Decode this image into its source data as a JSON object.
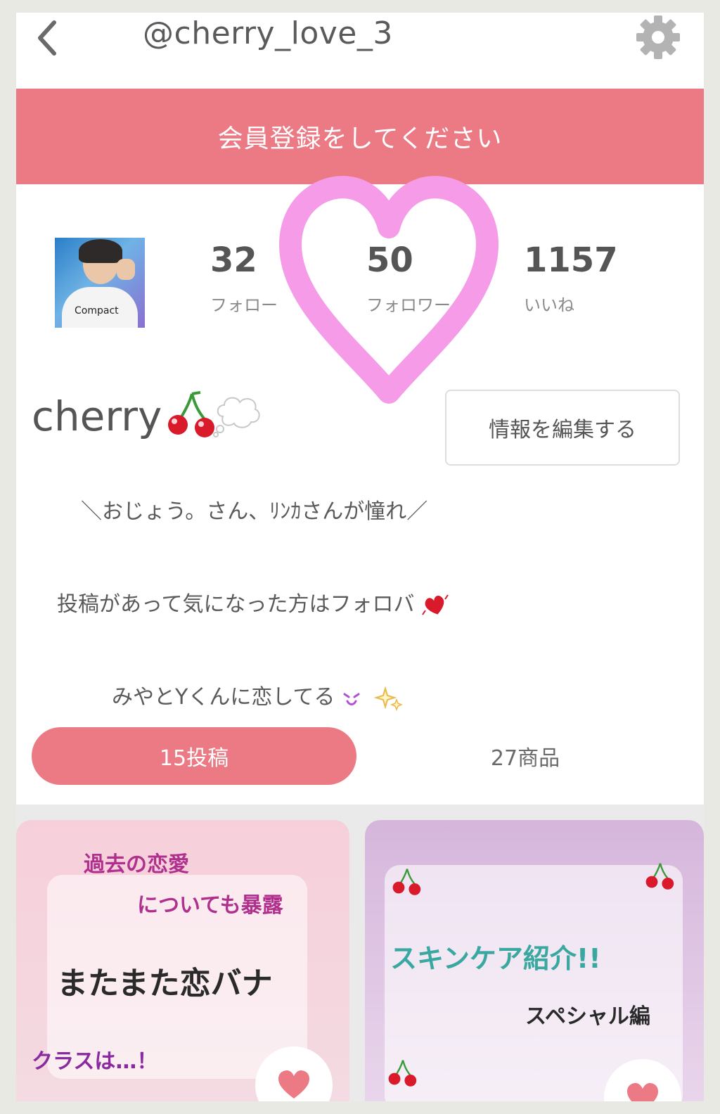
{
  "header": {
    "username": "@cherry_love_3"
  },
  "banner": {
    "text": "会員登録をしてください"
  },
  "stats": [
    {
      "value": "32",
      "label": "フォロー"
    },
    {
      "value": "50",
      "label": "フォロワー"
    },
    {
      "value": "1157",
      "label": "いいね"
    }
  ],
  "avatar": {
    "shirt_text": "Compact"
  },
  "profile": {
    "name": "cherry",
    "edit_label": "情報を編集する"
  },
  "bio": {
    "line1": "＼おじょう。さん、ﾘﾝｶさんが憧れ／",
    "line2": "投稿があって気になった方はフォロバ",
    "line3": "みやとYくんに恋してる"
  },
  "tabs": {
    "posts": "15投稿",
    "products": "27商品"
  },
  "cards": [
    {
      "line1": "過去の恋愛",
      "line2": "についても暴露",
      "line3": "またまた恋バナ",
      "line4": "クラスは…！"
    },
    {
      "line1": "スキンケア紹介!!",
      "line2": "スペシャル編"
    }
  ],
  "colors": {
    "accent": "#ec7a85",
    "heart_overlay": "#f59be8",
    "background": "#e9e9e4"
  }
}
